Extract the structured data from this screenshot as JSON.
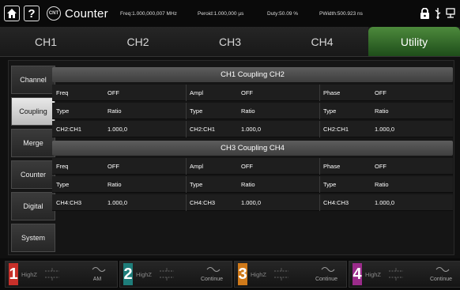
{
  "topbar": {
    "home_icon": "home-icon",
    "help_label": "?",
    "counter_icon_text": "CNT",
    "title": "Counter",
    "freq": "Freq:1.000,000,007 MHz",
    "period": "Peroid:1.000,000 µs",
    "duty": "Duty:50.09 %",
    "pwidth": "PWidth:500.923 ns"
  },
  "tabs": [
    {
      "label": "CH1",
      "active": false
    },
    {
      "label": "CH2",
      "active": false
    },
    {
      "label": "CH3",
      "active": false
    },
    {
      "label": "CH4",
      "active": false
    },
    {
      "label": "Utility",
      "active": true
    }
  ],
  "sidebar": [
    {
      "label": "Channel",
      "active": false
    },
    {
      "label": "Coupling",
      "active": true
    },
    {
      "label": "Merge",
      "active": false
    },
    {
      "label": "Counter",
      "active": false
    },
    {
      "label": "Digital",
      "active": false
    },
    {
      "label": "System",
      "active": false
    }
  ],
  "groups": [
    {
      "header": "CH1 Coupling CH2",
      "rows": [
        [
          {
            "k": "Freq",
            "v": "OFF"
          },
          {
            "k": "Ampl",
            "v": "OFF"
          },
          {
            "k": "Phase",
            "v": "OFF"
          }
        ],
        [
          {
            "k": "Type",
            "v": "Ratio"
          },
          {
            "k": "Type",
            "v": "Ratio"
          },
          {
            "k": "Type",
            "v": "Ratio"
          }
        ],
        [
          {
            "k": "CH2:CH1",
            "v": "1.000,0"
          },
          {
            "k": "CH2:CH1",
            "v": "1.000,0"
          },
          {
            "k": "CH2:CH1",
            "v": "1.000,0"
          }
        ]
      ]
    },
    {
      "header": "CH3 Coupling CH4",
      "rows": [
        [
          {
            "k": "Freq",
            "v": "OFF"
          },
          {
            "k": "Ampl",
            "v": "OFF"
          },
          {
            "k": "Phase",
            "v": "OFF"
          }
        ],
        [
          {
            "k": "Type",
            "v": "Ratio"
          },
          {
            "k": "Type",
            "v": "Ratio"
          },
          {
            "k": "Type",
            "v": "Ratio"
          }
        ],
        [
          {
            "k": "CH4:CH3",
            "v": "1.000,0"
          },
          {
            "k": "CH4:CH3",
            "v": "1.000,0"
          },
          {
            "k": "CH4:CH3",
            "v": "1.000,0"
          }
        ]
      ]
    }
  ],
  "channels": [
    {
      "num": "1",
      "impedance": "HighZ",
      "mode": "AM",
      "color": "#c8302a"
    },
    {
      "num": "2",
      "impedance": "HighZ",
      "mode": "Continue",
      "color": "#1e7d7a"
    },
    {
      "num": "3",
      "impedance": "HighZ",
      "mode": "Continue",
      "color": "#d07a1a"
    },
    {
      "num": "4",
      "impedance": "HighZ",
      "mode": "Continue",
      "color": "#9a2b8a"
    }
  ]
}
